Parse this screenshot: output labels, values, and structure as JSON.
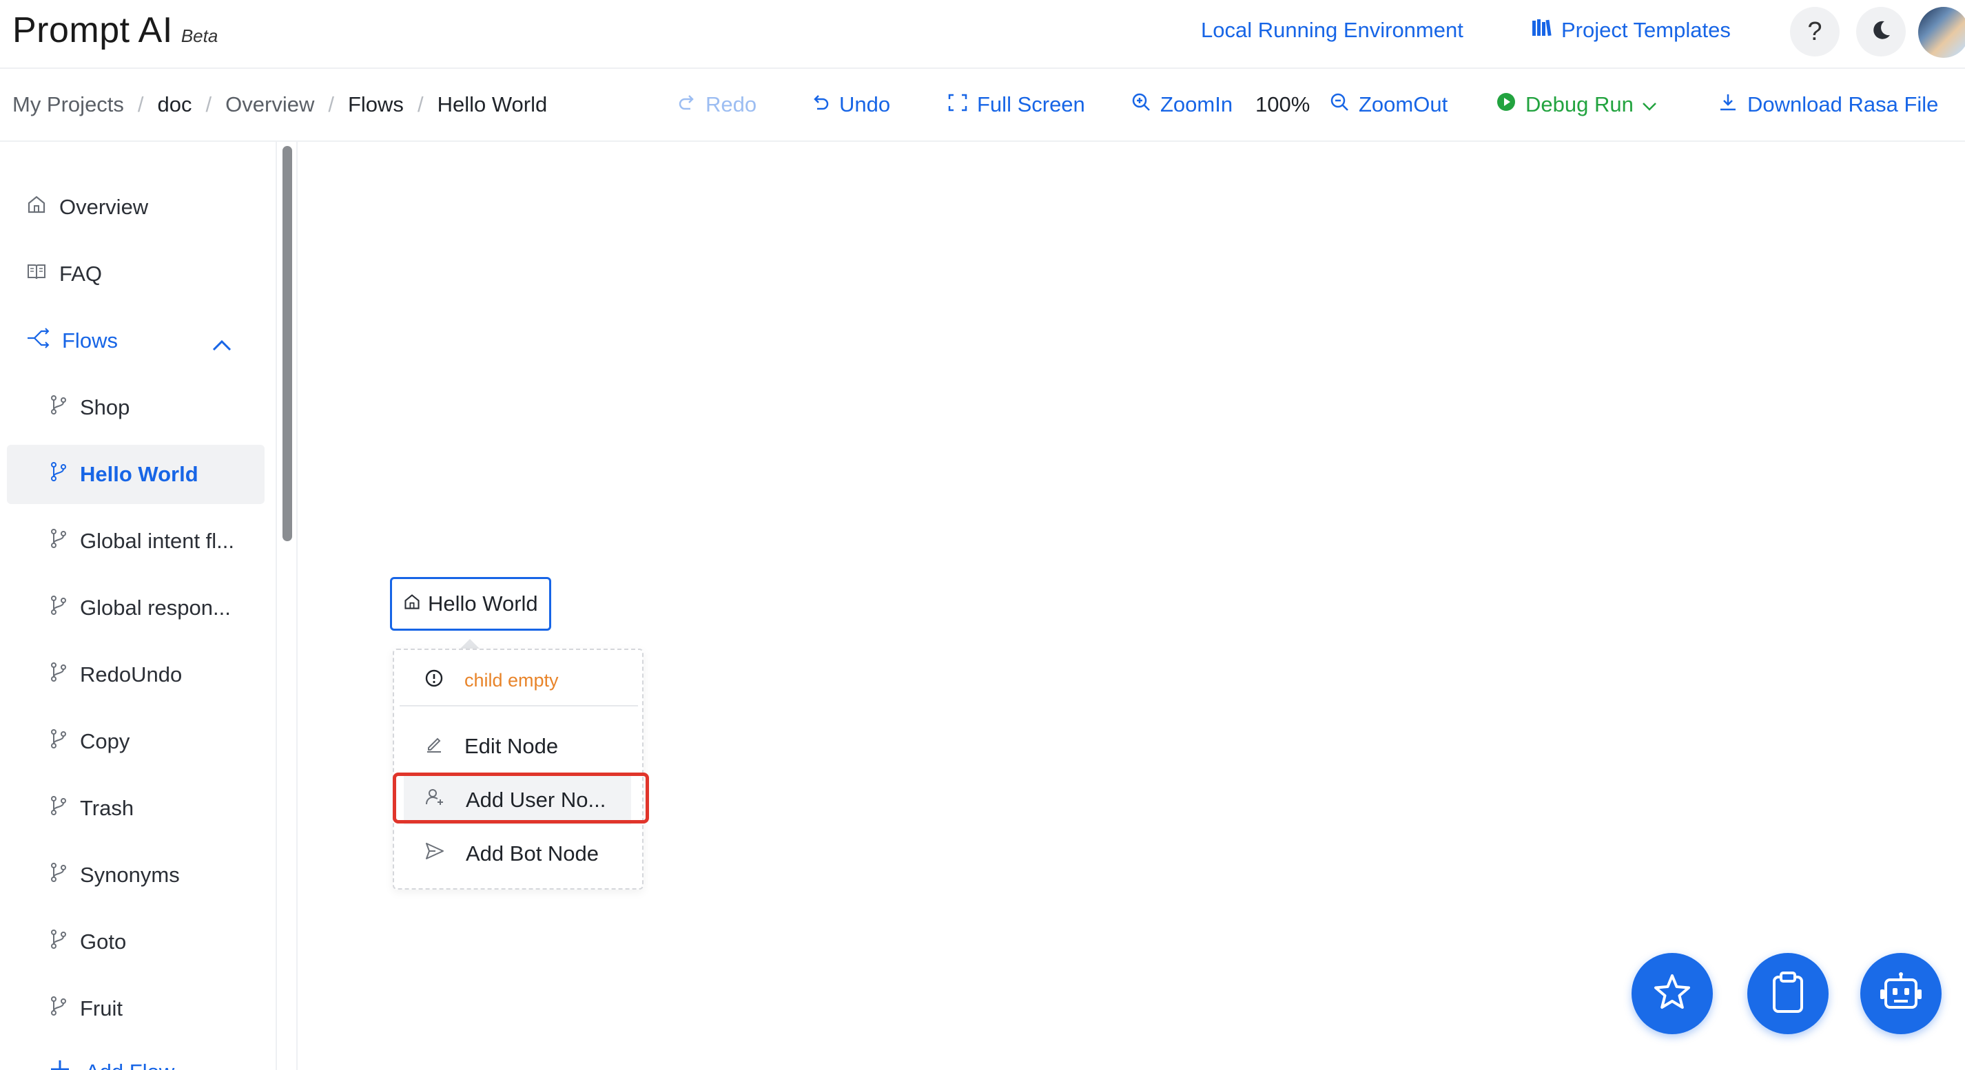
{
  "header": {
    "brand": "Prompt AI",
    "badge": "Beta",
    "local_env": "Local Running Environment",
    "templates": "Project Templates",
    "help": "?"
  },
  "breadcrumb": [
    "My Projects",
    "doc",
    "Overview",
    "Flows",
    "Hello World"
  ],
  "toolbar": {
    "redo": "Redo",
    "undo": "Undo",
    "fullscreen": "Full Screen",
    "zoom_in": "ZoomIn",
    "zoom_level": "100%",
    "zoom_out": "ZoomOut",
    "debug_run": "Debug Run",
    "download": "Download Rasa File"
  },
  "sidebar": {
    "overview": "Overview",
    "faq": "FAQ",
    "flows": "Flows",
    "flow_items": [
      "Shop",
      "Hello World",
      "Global intent fl...",
      "Global respon...",
      "RedoUndo",
      "Copy",
      "Trash",
      "Synonyms",
      "Goto",
      "Fruit"
    ],
    "active_flow": "Hello World",
    "add_flow": "Add Flow"
  },
  "canvas": {
    "node_label": "Hello World",
    "menu": {
      "warning": "child empty",
      "edit": "Edit Node",
      "add_user": "Add User No...",
      "add_bot": "Add Bot Node"
    }
  },
  "colors": {
    "accent": "#1765e6",
    "success": "#22a33f",
    "warning": "#e8842a",
    "highlight": "#e0352b",
    "fab": "#1a6be8"
  },
  "icons": {
    "fab_buttons": [
      "star-icon",
      "clipboard-icon",
      "robot-icon"
    ]
  }
}
